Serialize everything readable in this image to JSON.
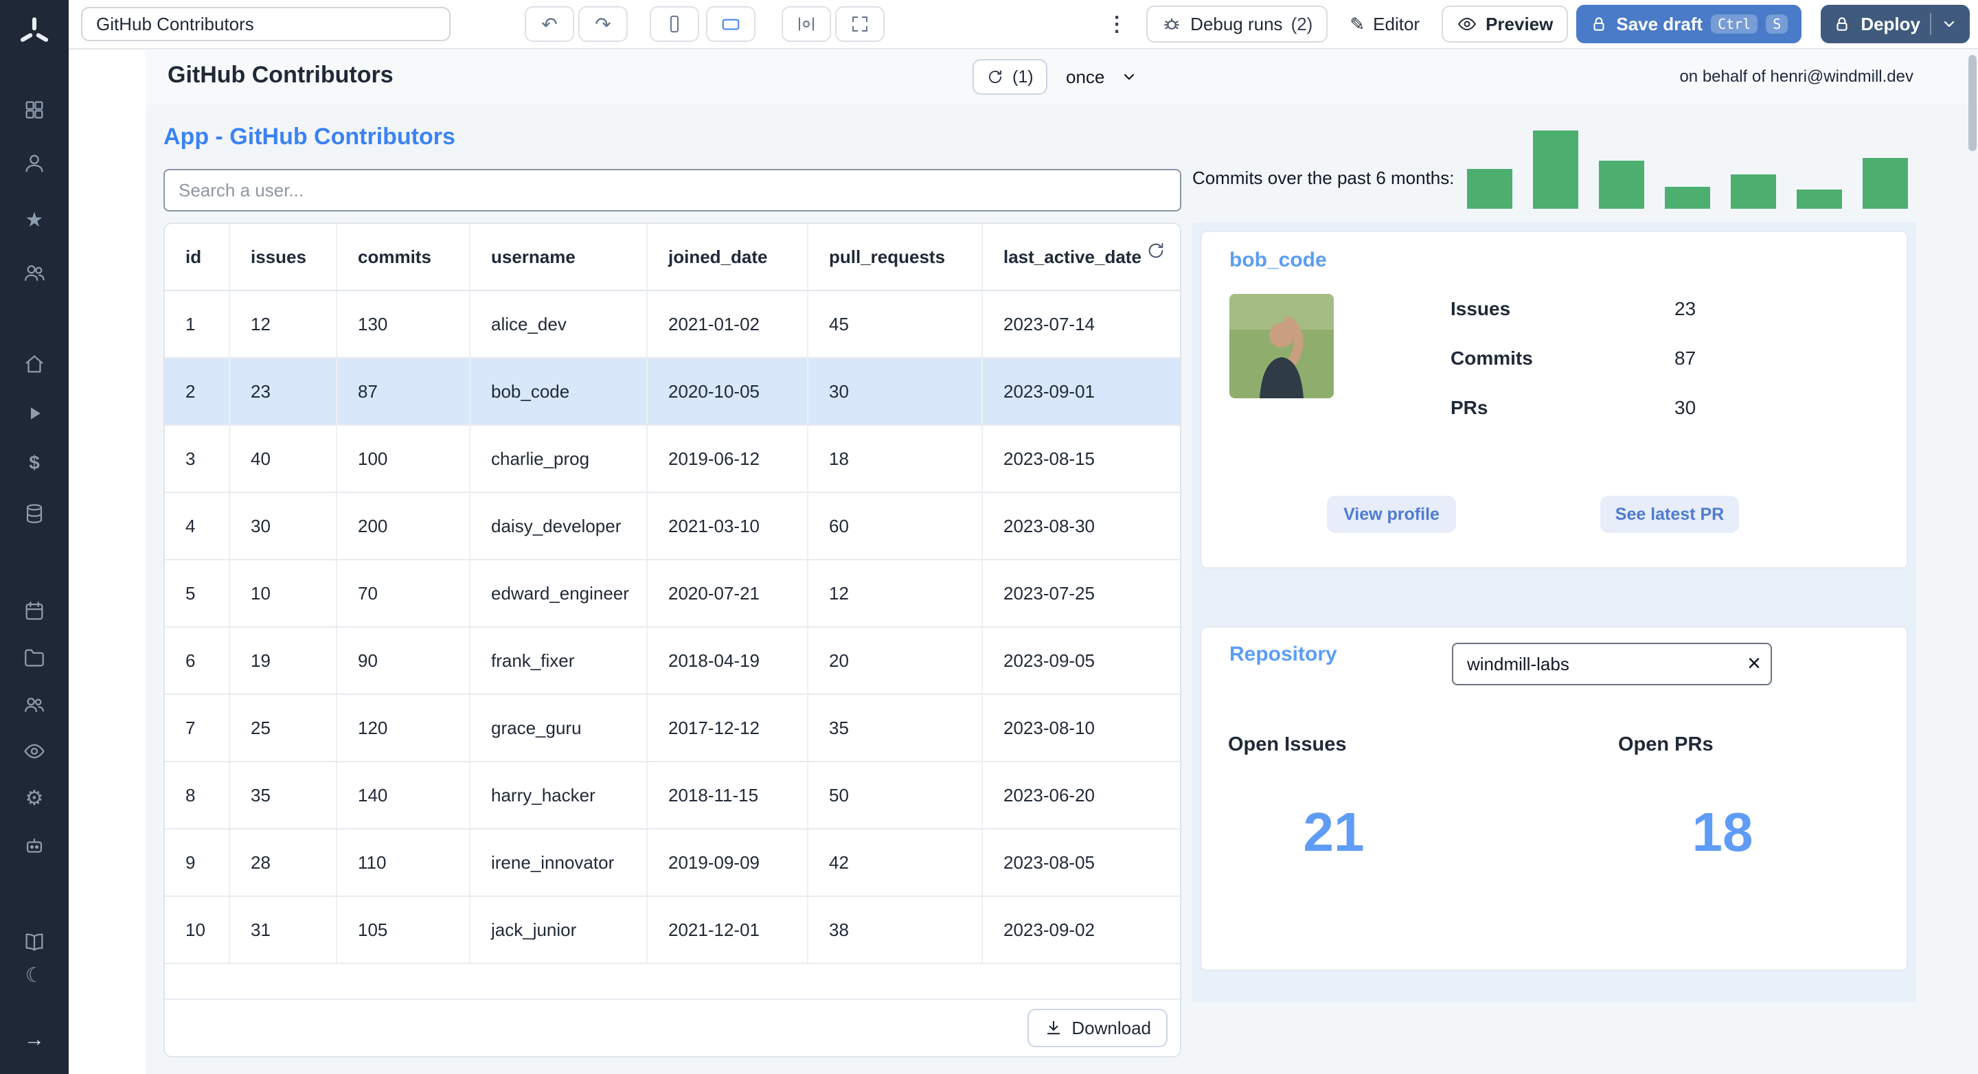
{
  "topbar": {
    "app_name_value": "GitHub Contributors",
    "debug_runs": {
      "label": "Debug runs",
      "count": "(2)"
    },
    "editor_label": "Editor",
    "preview_label": "Preview",
    "save_draft": {
      "label": "Save draft",
      "kbd": [
        "Ctrl",
        "S"
      ]
    },
    "deploy_label": "Deploy"
  },
  "app_header": {
    "title": "GitHub Contributors",
    "refresh_count": "(1)",
    "schedule": "once",
    "on_behalf_of": "on behalf of henri@windmill.dev"
  },
  "main": {
    "heading": "App - GitHub Contributors",
    "search_placeholder": "Search a user...",
    "table": {
      "columns": [
        "id",
        "issues",
        "commits",
        "username",
        "joined_date",
        "pull_requests",
        "last_active_date"
      ],
      "rows": [
        [
          "1",
          "12",
          "130",
          "alice_dev",
          "2021-01-02",
          "45",
          "2023-07-14"
        ],
        [
          "2",
          "23",
          "87",
          "bob_code",
          "2020-10-05",
          "30",
          "2023-09-01"
        ],
        [
          "3",
          "40",
          "100",
          "charlie_prog",
          "2019-06-12",
          "18",
          "2023-08-15"
        ],
        [
          "4",
          "30",
          "200",
          "daisy_developer",
          "2021-03-10",
          "60",
          "2023-08-30"
        ],
        [
          "5",
          "10",
          "70",
          "edward_engineer",
          "2020-07-21",
          "12",
          "2023-07-25"
        ],
        [
          "6",
          "19",
          "90",
          "frank_fixer",
          "2018-04-19",
          "20",
          "2023-09-05"
        ],
        [
          "7",
          "25",
          "120",
          "grace_guru",
          "2017-12-12",
          "35",
          "2023-08-10"
        ],
        [
          "8",
          "35",
          "140",
          "harry_hacker",
          "2018-11-15",
          "50",
          "2023-06-20"
        ],
        [
          "9",
          "28",
          "110",
          "irene_innovator",
          "2019-09-09",
          "42",
          "2023-08-05"
        ],
        [
          "10",
          "31",
          "105",
          "jack_junior",
          "2021-12-01",
          "38",
          "2023-09-02"
        ]
      ],
      "selected_index": 1,
      "download_label": "Download"
    },
    "chart_label": "Commits over the past 6 months:",
    "user_card": {
      "username": "bob_code",
      "stats": [
        {
          "label": "Issues",
          "value": "23"
        },
        {
          "label": "Commits",
          "value": "87"
        },
        {
          "label": "PRs",
          "value": "30"
        }
      ],
      "buttons": {
        "view_profile": "View profile",
        "see_latest_pr": "See latest PR"
      }
    },
    "repo_card": {
      "title": "Repository",
      "input_value": "windmill-labs",
      "open_issues": {
        "label": "Open Issues",
        "value": "21"
      },
      "open_prs": {
        "label": "Open PRs",
        "value": "18"
      }
    }
  },
  "chart_data": {
    "type": "bar",
    "title": "Commits over the past 6 months",
    "values": [
      29,
      57,
      35,
      16,
      25,
      14,
      37
    ],
    "bar_color": "#4caf70",
    "xlabel": "",
    "ylabel": "",
    "grid": false,
    "legend": false
  },
  "colors": {
    "accent_blue": "#3b82f6",
    "light_blue_text": "#5f9cf6",
    "bar_green": "#4caf70",
    "selected_row_bg": "#d9e7fa",
    "sidebar_bg": "#1e2836",
    "save_button_bg": "#4a7bc8",
    "deploy_button_bg": "#3f5a7d",
    "panel_bg": "#e8f0fa"
  }
}
